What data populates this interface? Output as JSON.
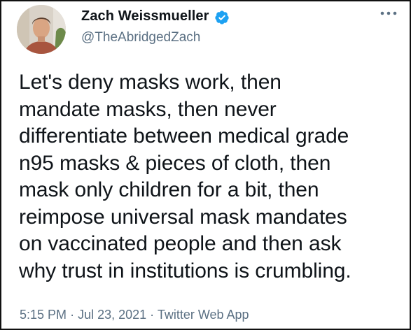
{
  "author": {
    "display_name": "Zach Weissmueller",
    "handle": "@TheAbridgedZach",
    "verified": true
  },
  "tweet": {
    "text": "Let's deny masks work, then\nmandate masks, then never\ndifferentiate between medical grade\nn95 masks & pieces of cloth, then\nmask only children for a bit, then\nreimpose universal mask mandates\non vaccinated people and then ask\nwhy trust in institutions is crumbling.",
    "time": "5:15 PM",
    "date": "Jul 23, 2021",
    "source": "Twitter Web App"
  },
  "icons": {
    "verified": "verified-badge-icon",
    "more": "more-options-icon"
  },
  "colors": {
    "text": "#0f1419",
    "secondary": "#5b7083",
    "verified_blue": "#1da1f2"
  }
}
